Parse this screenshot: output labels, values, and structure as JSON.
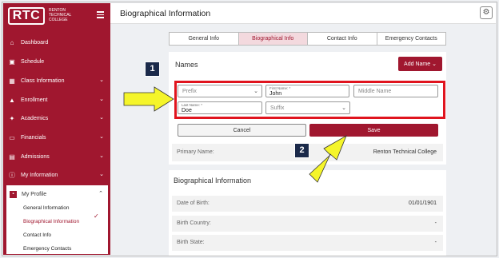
{
  "app": {
    "logo_text": "RTC",
    "logo_sub": "RENTON TECHNICAL COLLEGE",
    "page_title": "Biographical Information"
  },
  "sidebar": {
    "items": [
      {
        "label": "Dashboard",
        "icon": "home-icon"
      },
      {
        "label": "Schedule",
        "icon": "calendar-icon"
      },
      {
        "label": "Class Information",
        "icon": "grid-icon"
      },
      {
        "label": "Enrollment",
        "icon": "graduation-cap-icon"
      },
      {
        "label": "Academics",
        "icon": "academics-icon"
      },
      {
        "label": "Financials",
        "icon": "card-icon"
      },
      {
        "label": "Admissions",
        "icon": "id-card-icon"
      },
      {
        "label": "My Information",
        "icon": "info-icon"
      }
    ],
    "profile": {
      "label": "My Profile",
      "items": [
        "General Information",
        "Biographical Information",
        "Contact Info",
        "Emergency Contacts"
      ]
    }
  },
  "tabs": [
    "General Info",
    "Biographical Info",
    "Contact Info",
    "Emergency Contacts"
  ],
  "names": {
    "title": "Names",
    "add_button": "Add Name",
    "prefix_placeholder": "Prefix",
    "first_name_label": "First Name: *",
    "first_name_value": "John",
    "middle_placeholder": "Middle Name",
    "last_name_label": "Last Name: *",
    "last_name_value": "Doe",
    "suffix_placeholder": "Suffix",
    "cancel": "Cancel",
    "save": "Save",
    "primary_name_label": "Primary Name:",
    "primary_name_value": "Renton Technical College"
  },
  "bio": {
    "title": "Biographical Information",
    "rows": [
      {
        "label": "Date of Birth:",
        "value": "01/01/1901"
      },
      {
        "label": "Birth Country:",
        "value": "-"
      },
      {
        "label": "Birth State:",
        "value": "-"
      }
    ]
  },
  "callouts": [
    "1",
    "2"
  ],
  "colors": {
    "brand": "#a0172f",
    "highlight": "#e0141e",
    "callout_bg": "#1b2a4a",
    "arrow": "#f5f52a"
  }
}
